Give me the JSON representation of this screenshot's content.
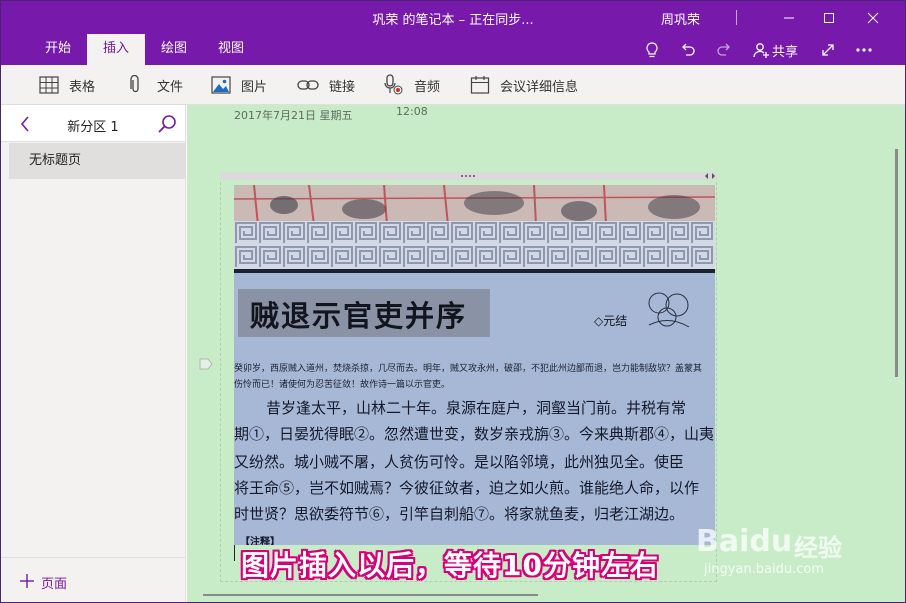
{
  "window": {
    "title": "巩荣 的笔记本 – 正在同步...",
    "user": "周巩荣"
  },
  "tabs": [
    {
      "label": "开始"
    },
    {
      "label": "插入",
      "active": true
    },
    {
      "label": "绘图"
    },
    {
      "label": "视图"
    }
  ],
  "toolbar_right": {
    "share_label": "共享",
    "icons": [
      "lightbulb-icon",
      "undo-icon",
      "redo-icon",
      "share-person-icon",
      "expand-icon",
      "more-icon"
    ]
  },
  "ribbon": {
    "items": [
      {
        "label": "表格",
        "icon": "table-icon"
      },
      {
        "label": "文件",
        "icon": "paperclip-icon"
      },
      {
        "label": "图片",
        "icon": "picture-icon"
      },
      {
        "label": "链接",
        "icon": "link-icon"
      },
      {
        "label": "音频",
        "icon": "microphone-icon"
      },
      {
        "label": "会议详细信息",
        "icon": "calendar-icon"
      }
    ]
  },
  "sidebar": {
    "section_name": "新分区 1",
    "pages": [
      {
        "label": "无标题页"
      }
    ],
    "add_page_label": "页面"
  },
  "page": {
    "date": "2017年7月21日  星期五",
    "time": "12:08"
  },
  "image_text": {
    "headline": "贼退示官吏并序",
    "author": "◇元结",
    "intro": "癸卯岁，西原贼入道州，焚烧杀掠，几尽而去。明年，贼又攻永州，破邵，不犯此州边鄙而退，岂力能制敌欤？盖蒙其伤怜而已！诸使何为忍苦征敛！故作诗一篇以示官吏。",
    "lines": [
      "昔岁逢太平，山林二十年。泉源在庭户，洞壑当门前。井税有常",
      "期①，日晏犹得眠②。忽然遭世变，数岁亲戎旃③。今来典斯郡④，山夷",
      "又纷然。城小贼不屠，人贫伤可怜。是以陷邻境，此州独见全。使臣",
      "将王命⑤，岂不如贼焉？今彼征敛者，迫之如火煎。谁能绝人命，以作",
      "时世贤？思欲委符节⑥，引竿自刺船⑦。将家就鱼麦，归老江湖边。"
    ],
    "footnote": "【注释】"
  },
  "caption": "图片插入以后，等待10分钟左右",
  "watermark": {
    "logo": "Baidu",
    "suffix": "经验",
    "url": "jingyan.baidu.com"
  },
  "colors": {
    "brand": "#7719aa",
    "canvas": "#c8ecc8",
    "caption_outline": "#d6007a"
  }
}
